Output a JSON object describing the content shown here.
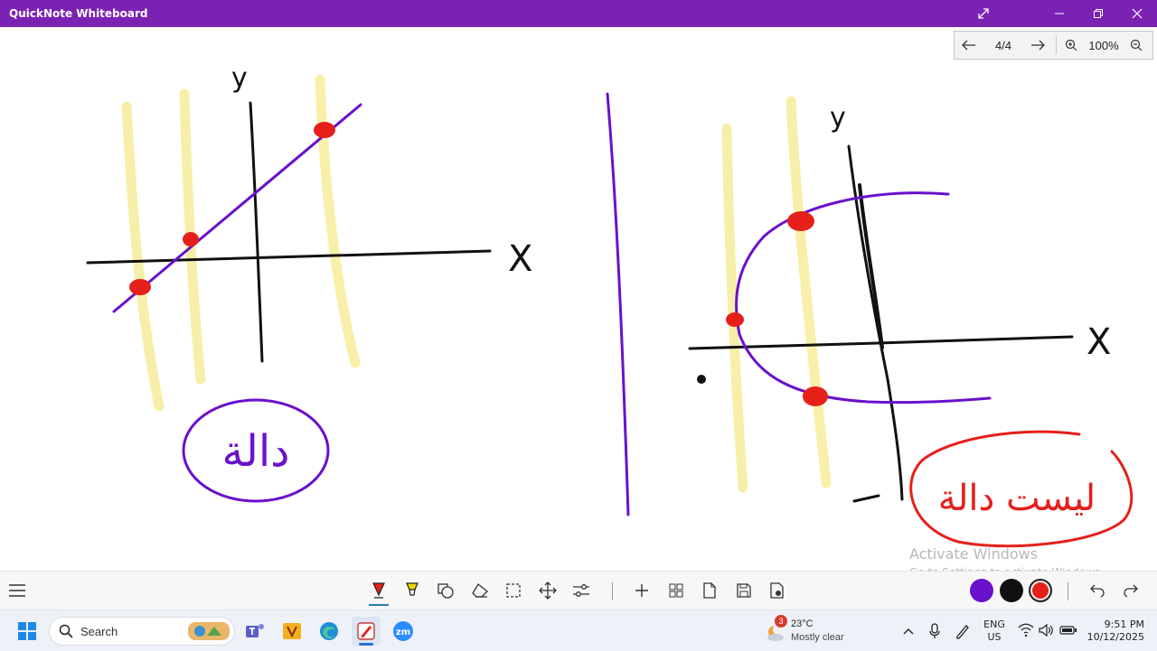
{
  "window": {
    "title": "QuickNote Whiteboard"
  },
  "pager": {
    "page": "4/4",
    "zoom": "100%"
  },
  "whiteboard": {
    "left_graph": {
      "y_label": "y",
      "x_label": "X",
      "verdict": "دالة"
    },
    "right_graph": {
      "y_label": "y",
      "x_label": "X",
      "verdict": "ليست دالة"
    },
    "colors": {
      "purple": "#6a11cb",
      "red": "#e5201b",
      "black": "#111111",
      "highlight": "#f7eea0"
    }
  },
  "watermark": {
    "line1": "Activate Windows",
    "line2": "Go to Settings to activate Windows."
  },
  "toolbar": {
    "tools": [
      "menu-icon",
      "pen-icon",
      "highlighter-icon",
      "shapes-icon",
      "eraser-icon",
      "lasso-select-icon",
      "pan-icon",
      "settings-sliders-icon",
      "add-page-icon",
      "grid-pages-icon",
      "page-icon",
      "save-icon",
      "export-icon"
    ],
    "colors": [
      "#6a11cb",
      "#111111",
      "#e5201b"
    ],
    "selected_color": "#e5201b"
  },
  "taskbar": {
    "search_placeholder": "Search",
    "weather": {
      "badge": "3",
      "temp": "23°C",
      "condition": "Mostly clear"
    },
    "language": {
      "lang": "ENG",
      "region": "US"
    },
    "clock": {
      "time": "9:51 PM",
      "date": "10/12/2025"
    }
  }
}
